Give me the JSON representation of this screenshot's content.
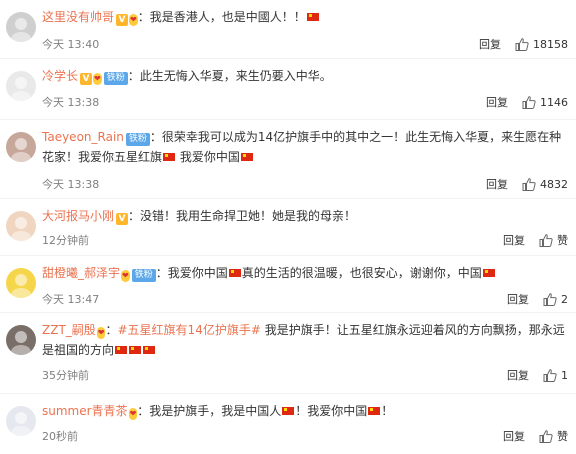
{
  "comments": [
    {
      "user": "这里没有帅哥",
      "v": "V",
      "has_vip": true,
      "vip": "❤",
      "has_fan": false,
      "fan": "",
      "text_a": "：我是香港人，也是中國人！！",
      "flags_a": 1,
      "text_b": "",
      "flags_b": 0,
      "time": "今天 13:40",
      "reply": "回复",
      "likes": "18158"
    },
    {
      "user": "冷学长",
      "v": "V",
      "has_vip": true,
      "vip": "❤",
      "has_fan": true,
      "fan": "铁粉",
      "text_a": "：此生无悔入华夏，来生仍要入中华。",
      "flags_a": 0,
      "text_b": "",
      "flags_b": 0,
      "time": "今天 13:38",
      "reply": "回复",
      "likes": "1146"
    },
    {
      "user": "Taeyeon_Rain",
      "v": "",
      "has_vip": false,
      "vip": "",
      "has_fan": true,
      "fan": "铁粉",
      "text_a": "：很荣幸我可以成为14亿护旗手中的其中之一！此生无悔入华夏，来生愿在种花家！我爱你五星红旗",
      "flags_a": 1,
      "text_b": " 我爱你中国",
      "flags_b": 1,
      "time": "今天 13:38",
      "reply": "回复",
      "likes": "4832"
    },
    {
      "user": "大河报马小刚",
      "v": "V",
      "has_vip": false,
      "vip": "",
      "has_fan": false,
      "fan": "",
      "text_a": "：没错！我用生命捍卫她！她是我的母亲！",
      "flags_a": 0,
      "text_b": "",
      "flags_b": 0,
      "time": "12分钟前",
      "reply": "回复",
      "likes": "赞"
    },
    {
      "user": "甜橙曦_郝泽宇",
      "v": "",
      "has_vip": true,
      "vip": "❤",
      "has_fan": true,
      "fan": "铁粉",
      "text_a": "：我爱你中国",
      "flags_a": 1,
      "text_b": "真的生活的很温暖，也很安心，谢谢你，中国",
      "flags_b": 1,
      "time": "今天 13:47",
      "reply": "回复",
      "likes": "2"
    },
    {
      "user": "ZZT_嗣殷",
      "v": "",
      "has_vip": true,
      "vip": "❤",
      "has_fan": false,
      "fan": "",
      "hashtag": "#五星红旗有14亿护旗手#",
      "text_a": " 我是护旗手！让五星红旗永远迎着风的方向飘扬，那永远是祖国的方向",
      "flags_a": 3,
      "text_b": "",
      "flags_b": 0,
      "time": "35分钟前",
      "reply": "回复",
      "likes": "1"
    },
    {
      "user": "summer青青茶",
      "v": "",
      "has_vip": true,
      "vip": "❤",
      "has_fan": false,
      "fan": "",
      "text_a": "：我是护旗手，我是中国人",
      "flags_a": 1,
      "text_b": "！我爱你中国",
      "flags_b": 1,
      "text_c": "！",
      "time": "20秒前",
      "reply": "回复",
      "likes": "赞"
    }
  ]
}
